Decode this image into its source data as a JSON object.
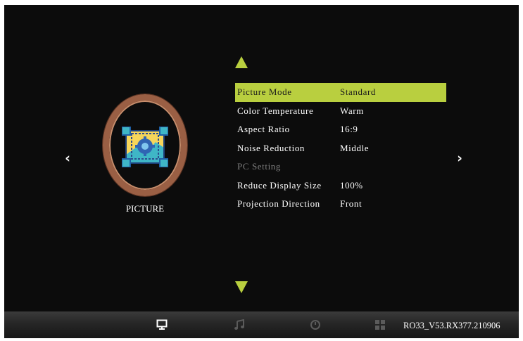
{
  "menu": {
    "items": [
      {
        "label": "Picture Mode",
        "value": "Standard"
      },
      {
        "label": "Color Temperature",
        "value": "Warm"
      },
      {
        "label": "Aspect Ratio",
        "value": "16:9"
      },
      {
        "label": "Noise Reduction",
        "value": "Middle"
      },
      {
        "label": "PC Setting",
        "value": ""
      },
      {
        "label": "Reduce Display Size",
        "value": "100%"
      },
      {
        "label": "Projection Direction",
        "value": "Front"
      }
    ],
    "selected_index": 0,
    "disabled_index": 4
  },
  "section": {
    "label": "PICTURE",
    "icon": "picture-settings-icon"
  },
  "nav": {
    "left": "‹",
    "right": "›",
    "up_icon": "arrow-up-icon",
    "down_icon": "arrow-down-icon"
  },
  "bottom_bar": {
    "icons": [
      "monitor-icon",
      "music-note-icon",
      "clock-icon",
      "grid-icon"
    ],
    "active_icon": "monitor-icon",
    "version": "RO33_V53.RX377.210906"
  },
  "colors": {
    "accent": "#b9cf3f",
    "background": "#0c0c0c",
    "ring": "#9a5f44",
    "disabled_text": "#7d7d7d"
  }
}
